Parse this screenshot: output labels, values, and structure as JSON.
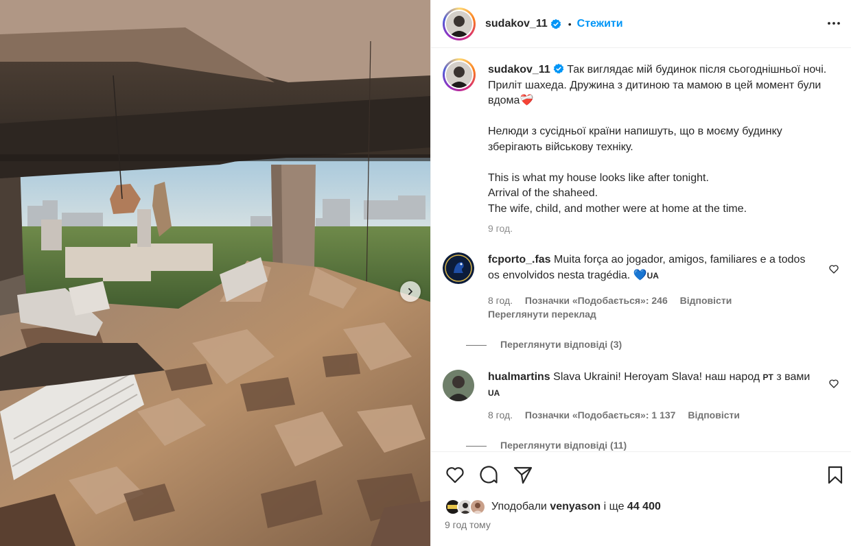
{
  "post": {
    "author": "sudakov_11",
    "follow_label": "Стежити",
    "separator": "•",
    "caption_lines_1": "Так виглядає мій будинок після сьогоднішньої ночі. Приліт шахеда. Дружина з дитиною та мамою в цей момент були вдома",
    "caption_emoji_1": "❤️‍🩹",
    "caption_para_2": "Нелюди з сусідньої країни напишуть, що в моєму будинку зберігають військову техніку.",
    "caption_en_1": "This is what my house looks like after tonight.",
    "caption_en_2": "Arrival of the shaheed.",
    "caption_en_3": "The wife, child, and mother were at home at the time.",
    "caption_time": "9 год."
  },
  "comments": [
    {
      "user": "fcporto_.fas",
      "text": "Muita força ao jogador, amigos, familiares e a todos os envolvidos nesta tragédia.",
      "emoji": "💙",
      "flag": "UA",
      "time": "8 год.",
      "likes": "Позначки «Подобається»: 246",
      "reply_label": "Відповісти",
      "translate_label": "Переглянути переклад",
      "replies_label": "Переглянути відповіді (3)"
    },
    {
      "user": "hualmartins",
      "text_a": "Slava Ukraini! Heroyam Slava! наш народ",
      "flag_a": "PT",
      "text_b": "з вами",
      "flag_b": "UA",
      "time": "8 год.",
      "likes": "Позначки «Подобається»: 1 137",
      "reply_label": "Відповісти",
      "replies_label": "Переглянути відповіді (11)"
    }
  ],
  "likes": {
    "prefix": "Уподобали",
    "user": "venyason",
    "middle": "і ще",
    "count": "44 400"
  },
  "post_time": "9 год тому",
  "icons": {
    "like": "heart-icon",
    "comment": "comment-icon",
    "share": "paper-plane-icon",
    "save": "bookmark-icon",
    "more": "more-horizontal-icon",
    "next": "chevron-right-icon",
    "verified": "verified-badge-icon"
  },
  "colors": {
    "accent": "#0095f6",
    "text": "#262626",
    "muted": "#737373",
    "verified": "#0095f6"
  }
}
